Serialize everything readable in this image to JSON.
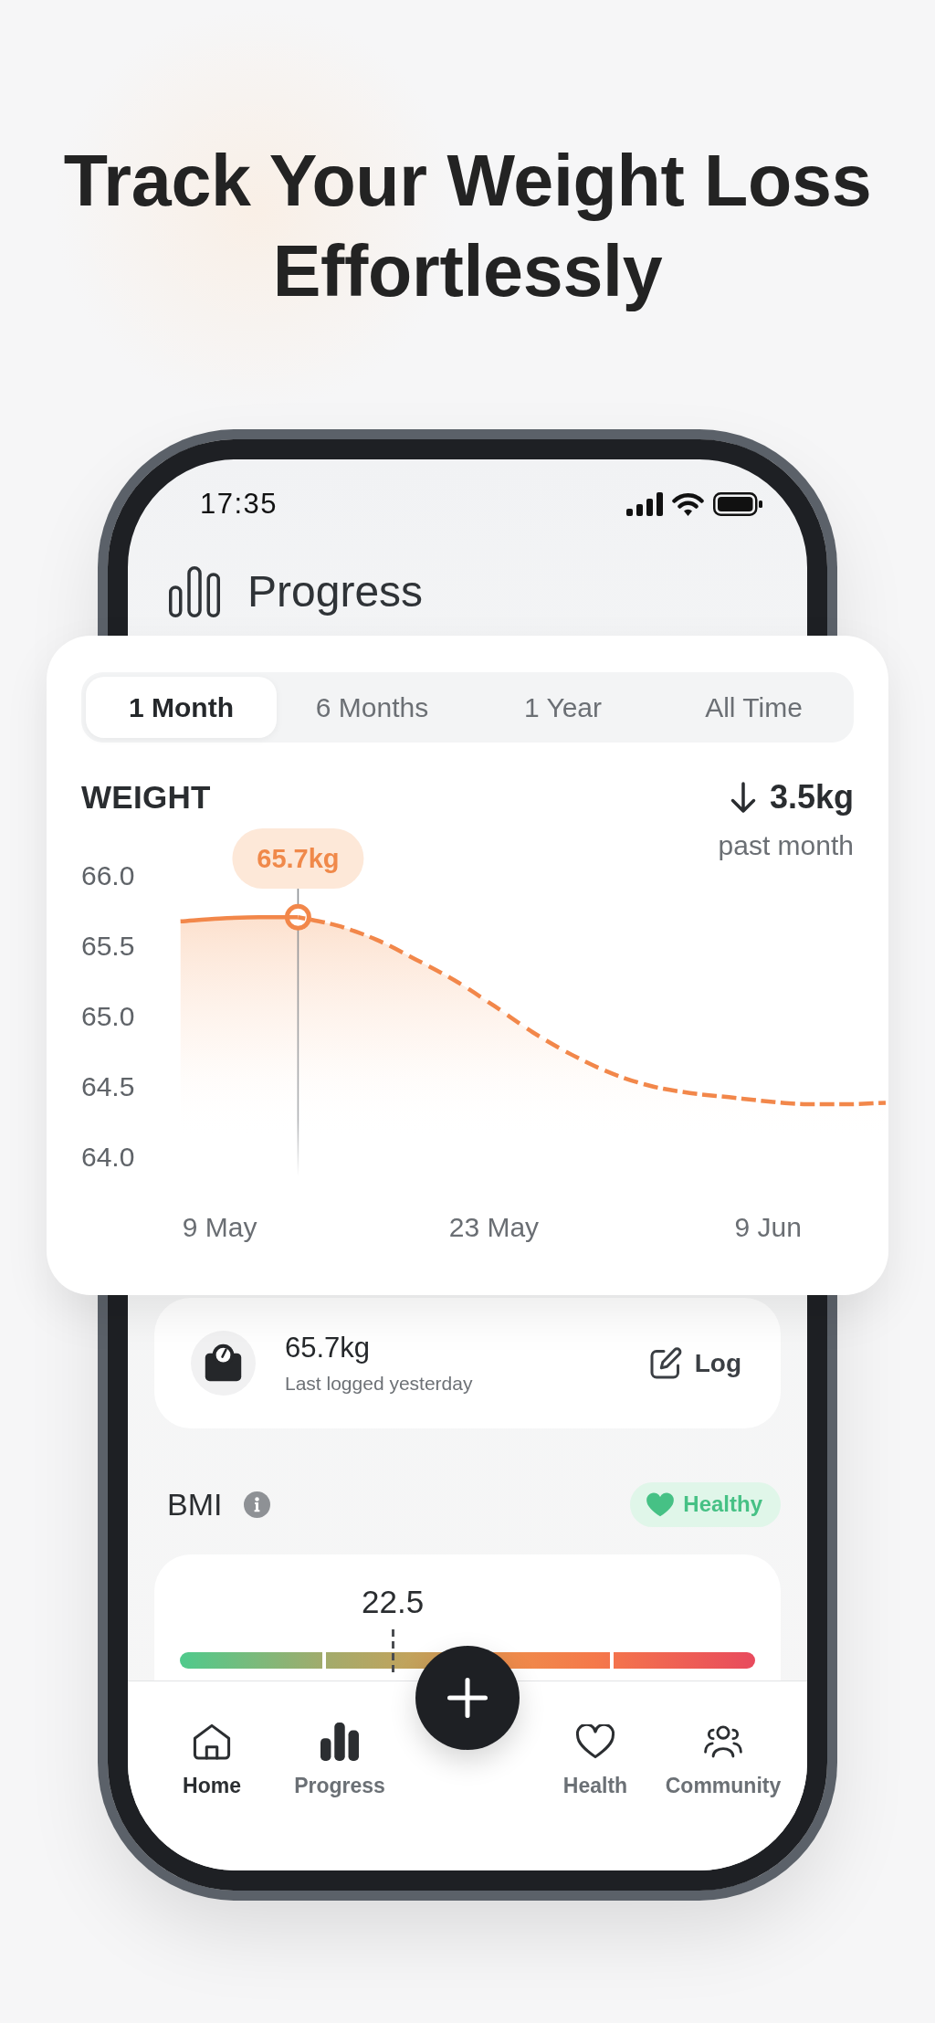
{
  "headline": "Track Your Weight Loss Effortlessly",
  "phone": {
    "status_bar": {
      "time": "17:35"
    },
    "header": {
      "title": "Progress"
    },
    "weight_card": {
      "ranges": [
        {
          "label": "1 Month",
          "selected": true
        },
        {
          "label": "6 Months",
          "selected": false
        },
        {
          "label": "1 Year",
          "selected": false
        },
        {
          "label": "All Time",
          "selected": false
        }
      ],
      "title": "WEIGHT",
      "change": "3.5kg",
      "change_period": "past month",
      "chart_data": {
        "type": "area",
        "ylim": [
          64.0,
          66.0
        ],
        "yticks": [
          {
            "value": 66,
            "label": "66.0"
          },
          {
            "value": 65.5,
            "label": "65.5"
          },
          {
            "value": 65,
            "label": "65.0"
          },
          {
            "value": 64.5,
            "label": "64.5"
          },
          {
            "value": 64,
            "label": "64.0"
          }
        ],
        "categories": [
          null,
          "9 May",
          null,
          null,
          null,
          null,
          null,
          null,
          "23 May",
          null,
          null,
          null,
          null,
          null,
          null,
          "9 Jun",
          null,
          null,
          null
        ],
        "series": [
          {
            "color": "#f2874a",
            "line_style": "solid",
            "values": [
              65.67,
              65.69,
              65.7,
              65.7,
              null,
              null,
              null,
              null,
              null,
              null,
              null,
              null,
              null,
              null,
              null,
              null,
              null,
              null,
              null
            ]
          },
          {
            "color": "#f2874a",
            "line_style": "dashed",
            "values": [
              null,
              null,
              null,
              65.7,
              65.64,
              65.54,
              65.4,
              65.25,
              65.07,
              64.88,
              64.72,
              64.59,
              64.5,
              64.45,
              64.42,
              64.39,
              64.37,
              64.37,
              64.38
            ]
          }
        ],
        "annotations": [
          {
            "y": 65.7,
            "text": "65.7kg"
          }
        ]
      }
    },
    "latest_entry": {
      "value": "65.7kg",
      "caption": "Last logged yesterday",
      "action": "Log"
    },
    "bmi": {
      "title": "BMI",
      "status": "Healthy",
      "value": "22.5",
      "level": 0.37
    },
    "nav": {
      "items": [
        {
          "label": "Home",
          "selected": true
        },
        {
          "label": "Progress",
          "selected": false
        },
        {
          "label": "Health",
          "selected": false
        },
        {
          "label": "Community",
          "selected": false
        }
      ]
    }
  }
}
